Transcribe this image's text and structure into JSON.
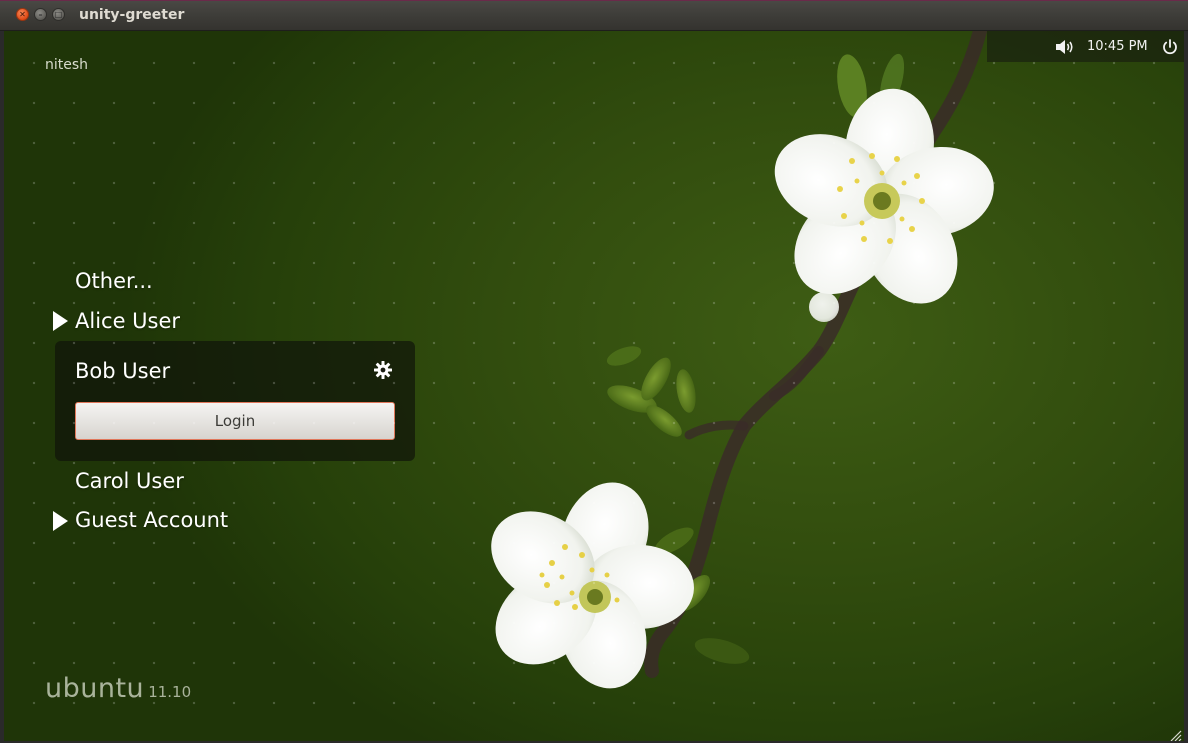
{
  "window": {
    "title": "unity-greeter"
  },
  "panel": {
    "time": "10:45 PM",
    "volume_icon": "speaker-volume-icon",
    "power_icon": "power-icon"
  },
  "greeter": {
    "hostname": "nitesh",
    "users": [
      {
        "label": "Other...",
        "has_arrow": false
      },
      {
        "label": "Alice User",
        "has_arrow": true
      },
      {
        "label": "Bob User",
        "has_arrow": false,
        "selected": true
      },
      {
        "label": "Carol User",
        "has_arrow": false
      },
      {
        "label": "Guest Account",
        "has_arrow": true
      }
    ],
    "selected_user": "Bob User",
    "login_button": "Login",
    "session_icon": "gear-icon"
  },
  "branding": {
    "logo": "ubuntu",
    "version": "11.10"
  },
  "colors": {
    "background": "#334f0e",
    "accent": "#e0775a",
    "close_button": "#df4a16"
  }
}
